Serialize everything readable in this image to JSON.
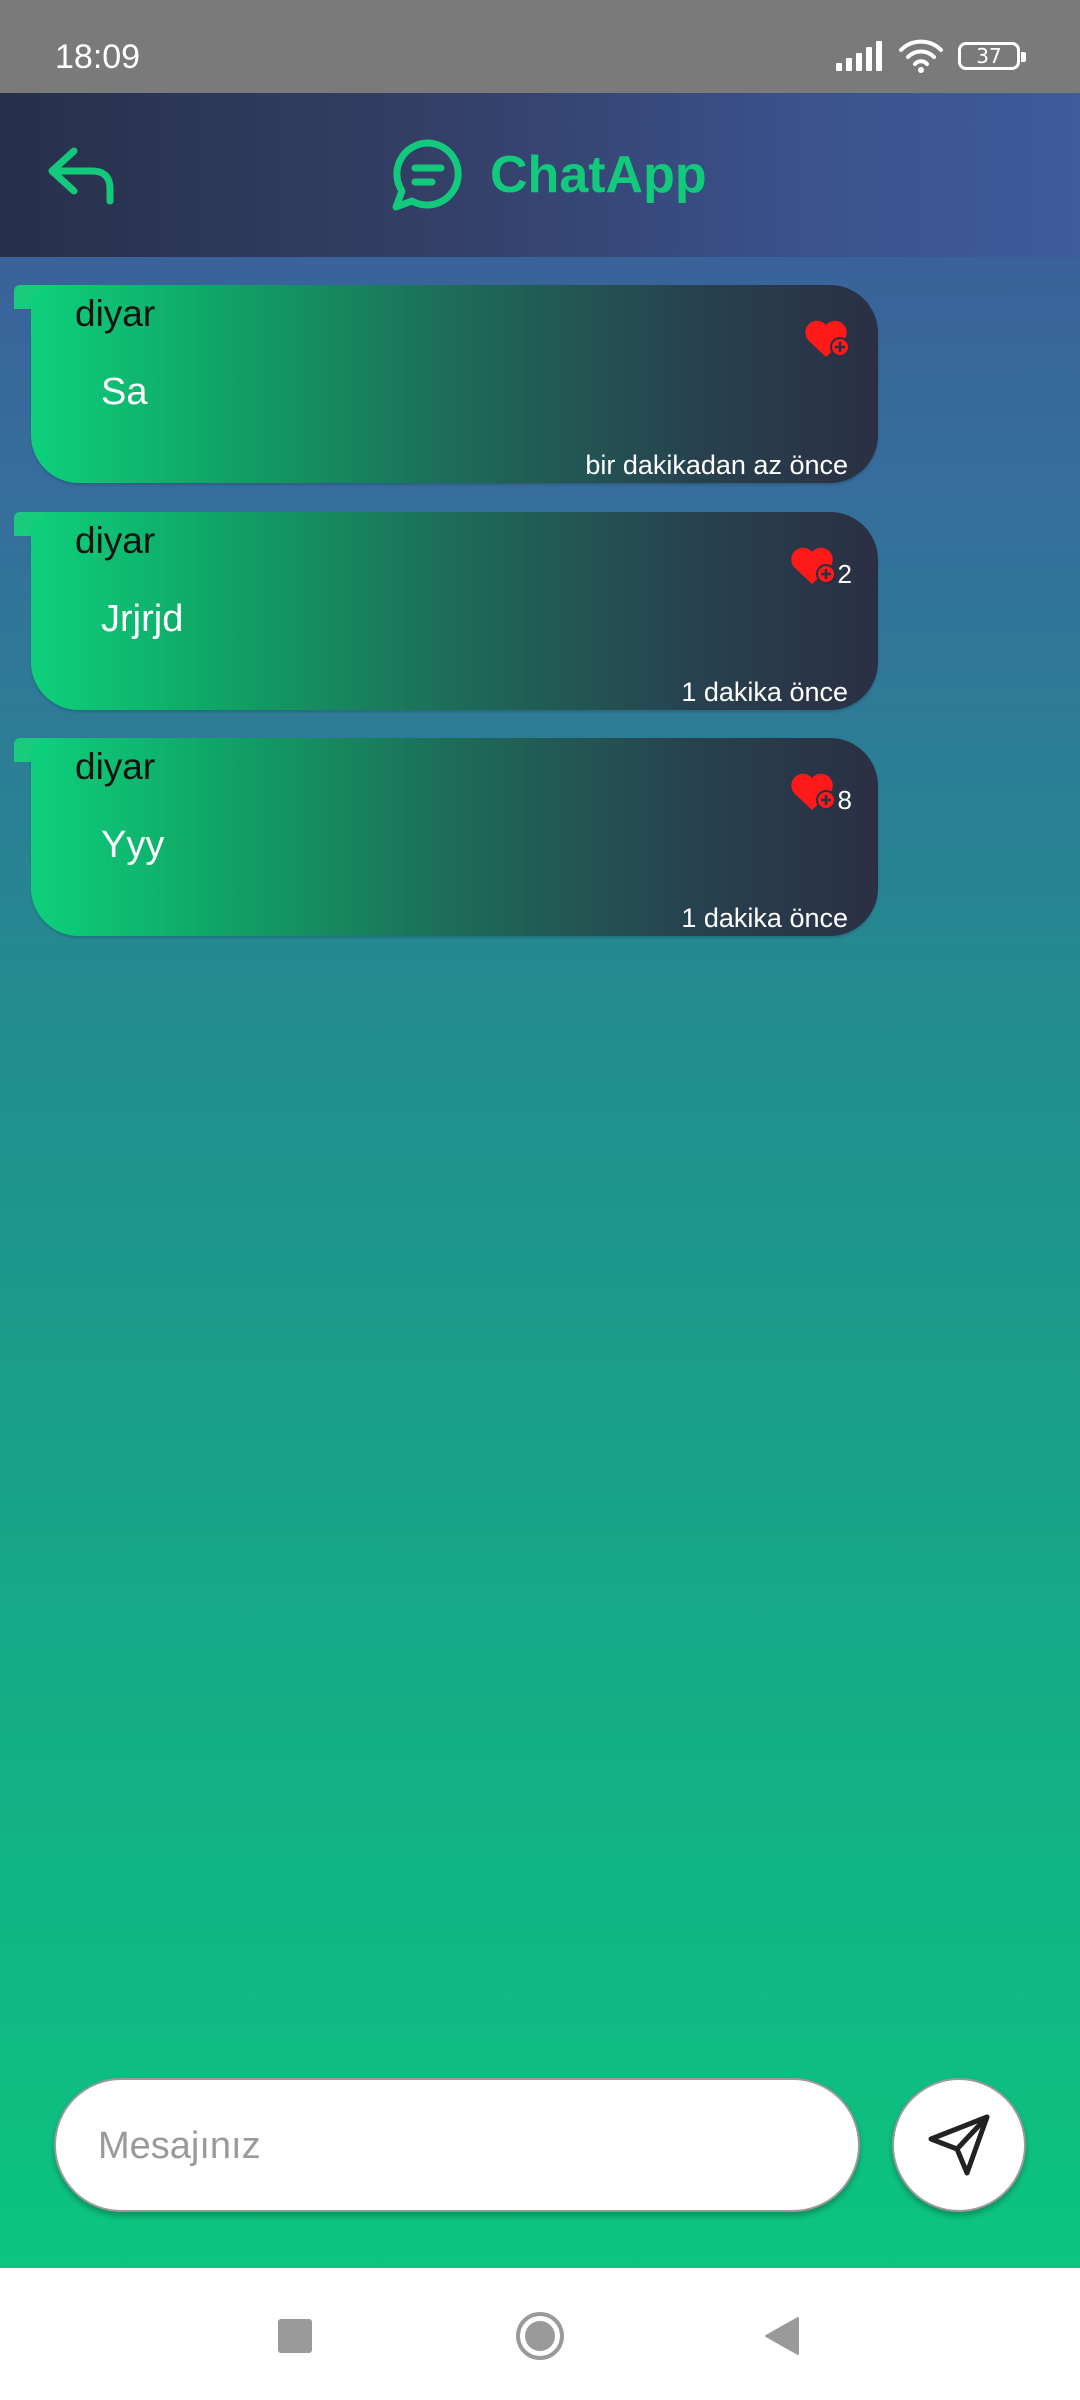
{
  "status_bar": {
    "time": "18:09",
    "battery": "37",
    "icons": [
      "signal-icon",
      "wifi-icon",
      "battery-icon"
    ]
  },
  "header": {
    "back_icon": "back-arrow-icon",
    "logo_icon": "chat-bubble-icon",
    "title": "ChatApp"
  },
  "messages": [
    {
      "user": "diyar",
      "text": "Sa",
      "time": "bir dakikadan az önce",
      "likes": ""
    },
    {
      "user": "diyar",
      "text": "Jrjrjd",
      "time": "1 dakika önce",
      "likes": "2"
    },
    {
      "user": "diyar",
      "text": "Yyy",
      "time": "1 dakika önce",
      "likes": "8"
    }
  ],
  "composer": {
    "placeholder": "Mesajınız",
    "value": "",
    "send_icon": "send-icon"
  },
  "nav": [
    "recents-square-icon",
    "home-circle-icon",
    "back-triangle-icon"
  ],
  "colors": {
    "accent": "#13c97c",
    "heart": "#ff1a1a",
    "status_bar": "#7a7a7a",
    "app_bar_dark": "#27304a"
  }
}
